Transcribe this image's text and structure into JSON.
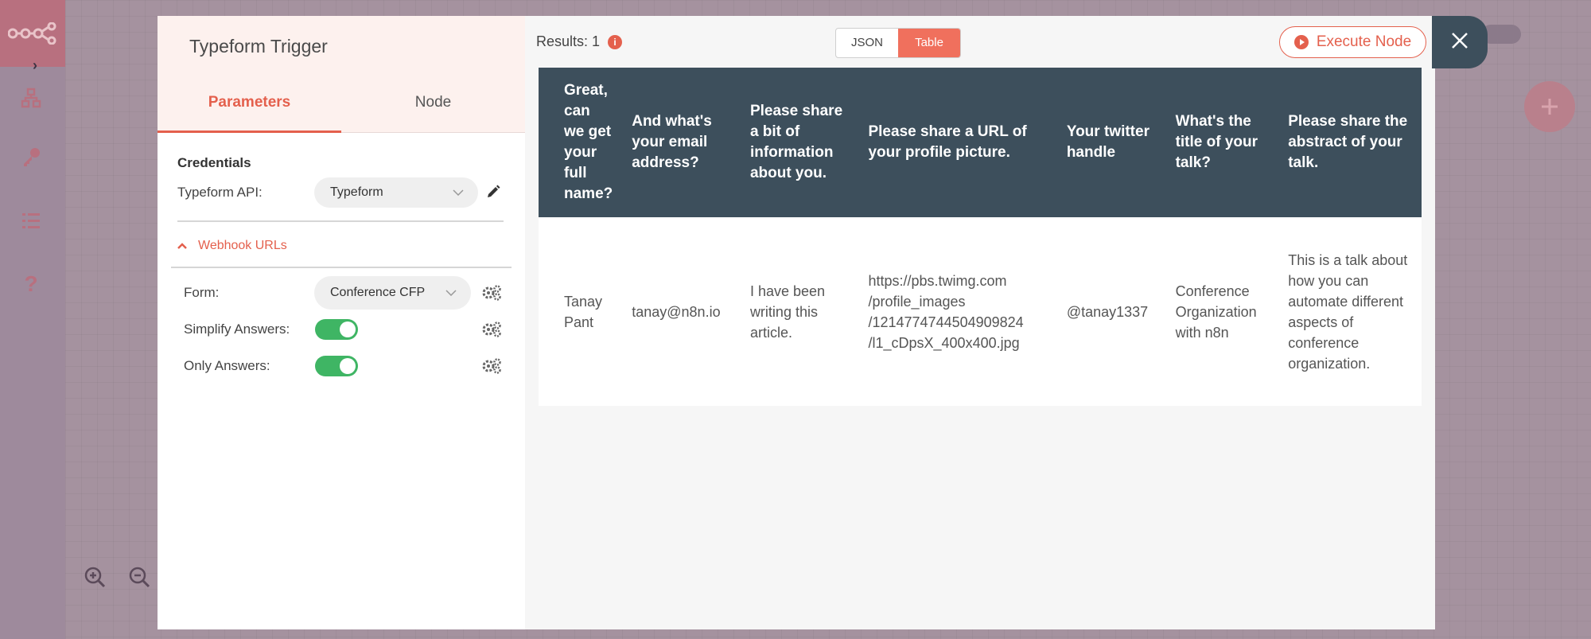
{
  "dialog": {
    "node_title": "Typeform Trigger",
    "tabs": [
      {
        "label": "Parameters",
        "active": true
      },
      {
        "label": "Node",
        "active": false
      }
    ]
  },
  "parameters": {
    "credentials_heading": "Credentials",
    "credential_label": "Typeform API:",
    "credential_value": "Typeform",
    "webhook_urls_label": "Webhook URLs",
    "form_label": "Form:",
    "form_value": "Conference CFP",
    "simplify_label": "Simplify Answers:",
    "simplify_on": true,
    "only_answers_label": "Only Answers:",
    "only_answers_on": true
  },
  "output": {
    "results_label": "Results: 1",
    "json_label": "JSON",
    "table_label": "Table",
    "active_view": "Table",
    "execute_label": "Execute Node"
  },
  "table": {
    "headers": [
      "Great, can we get your full name?",
      "And what's your email address?",
      "Please share a bit of information about you.",
      "Please share a URL of your profile picture.",
      "Your twitter handle",
      "What's the title of your talk?",
      "Please share the abstract of your talk."
    ],
    "rows": [
      [
        "Tanay Pant",
        "tanay@n8n.io",
        "I have been writing this article.",
        "https://pbs.twimg.com /profile_images /1214774744504909824 /l1_cDpsX_400x400.jpg",
        "@tanay1337",
        "Conference Organization with n8n",
        "This is a talk about how you can automate different aspects of conference organization."
      ]
    ]
  },
  "colors": {
    "accent": "#e4604d",
    "table_header": "#3d4f5c",
    "toggle_on": "#3fb564"
  }
}
